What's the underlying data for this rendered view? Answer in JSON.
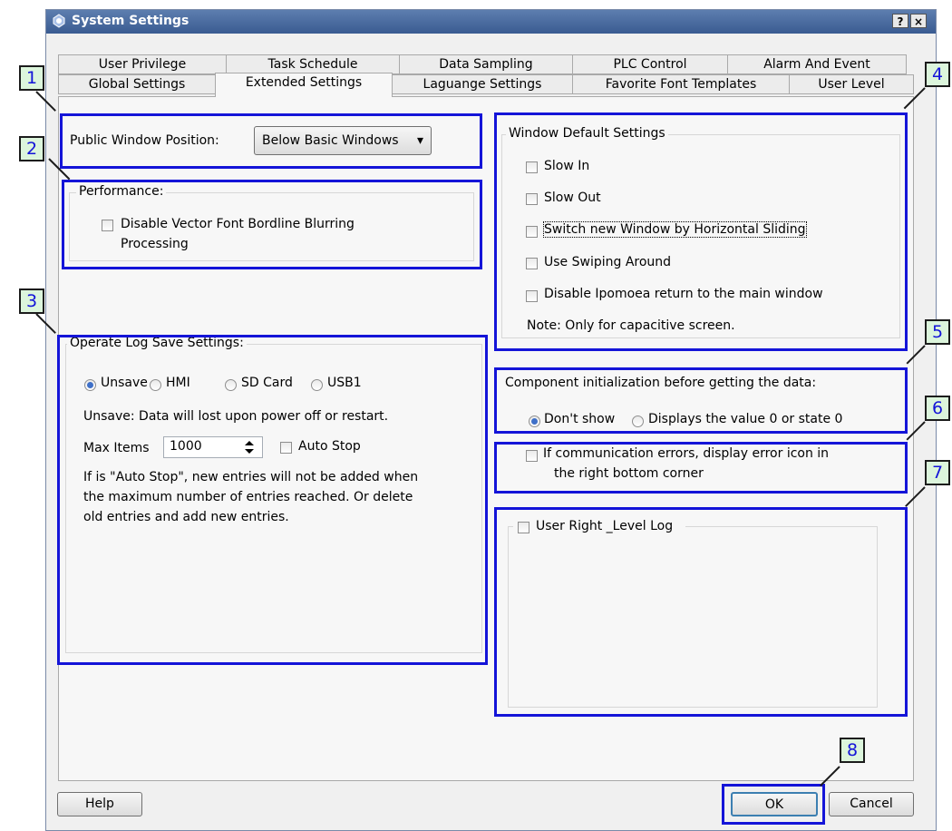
{
  "window": {
    "title": "System Settings",
    "help_button": "?",
    "close_button": "×"
  },
  "tabs": {
    "row1": [
      "User Privilege",
      "Task Schedule",
      "Data Sampling",
      "PLC Control",
      "Alarm And Event"
    ],
    "row2": [
      "Global Settings",
      "Extended Settings",
      "Laguange Settings",
      "Favorite Font Templates",
      "User Level"
    ],
    "active": "Extended Settings"
  },
  "public_window": {
    "label": "Public Window Position:",
    "value": "Below Basic Windows",
    "arrow": "▾"
  },
  "performance": {
    "title": "Performance:",
    "option_line1": "Disable Vector Font Bordline Blurring",
    "option_line2": "Processing"
  },
  "window_defaults": {
    "title": "Window Default Settings",
    "options": [
      "Slow In",
      "Slow Out",
      "Switch new Window by Horizontal Sliding",
      "Use Swiping Around",
      "Disable Ipomoea return to the main window"
    ],
    "note": "Note: Only for capacitive screen."
  },
  "operate_log": {
    "title": "Operate Log Save Settings:",
    "radios": [
      "Unsave",
      "HMI",
      "SD Card",
      "USB1"
    ],
    "selected": "Unsave",
    "unsave_note": "Unsave: Data will lost upon power off or restart.",
    "max_items_label": "Max Items",
    "max_items_value": "1000",
    "auto_stop_label": "Auto Stop",
    "description": [
      "If is \"Auto Stop\", new entries will not be added when",
      "the maximum number of entries reached. Or delete",
      "old entries and add new entries."
    ]
  },
  "component_init": {
    "title": "Component initialization before getting the data:",
    "options": [
      "Don't show",
      "Displays the value 0 or state 0"
    ],
    "selected": "Don't show"
  },
  "comm_errors": {
    "line1": "If communication errors, display error icon in",
    "line2": "the right bottom corner"
  },
  "user_right": {
    "label": "User Right _Level Log"
  },
  "buttons": {
    "help": "Help",
    "ok": "OK",
    "cancel": "Cancel"
  },
  "callouts": [
    "1",
    "2",
    "3",
    "4",
    "5",
    "6",
    "7",
    "8"
  ],
  "colors": {
    "highlight": "#1414d8",
    "badge_fill": "#dcf5dc",
    "titlebar": "#3a5b91",
    "radio_dot": "#3f70c8"
  }
}
